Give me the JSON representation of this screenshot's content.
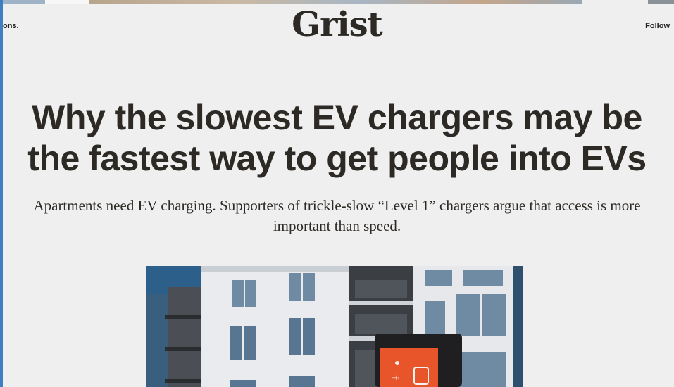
{
  "header": {
    "left_text": "ons.",
    "logo": "Grist",
    "follow_label": "Follow"
  },
  "article": {
    "headline": "Why the slowest EV chargers may be the fastest way to get people into EVs",
    "dek": "Apartments need EV charging. Supporters of trickle-slow “Level 1” chargers argue that access is more important than speed."
  },
  "colors": {
    "background": "#efefef",
    "text": "#2d2a26",
    "accent": "#3d7fc0",
    "charger_orange": "#e8552a"
  }
}
